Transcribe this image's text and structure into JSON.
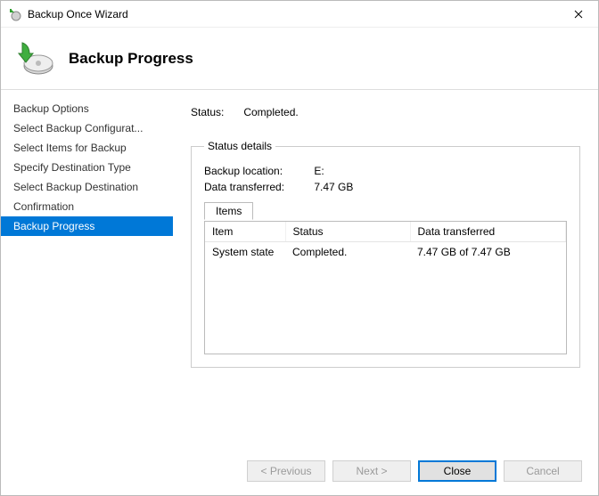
{
  "window": {
    "title": "Backup Once Wizard"
  },
  "header": {
    "title": "Backup Progress"
  },
  "sidebar": {
    "items": [
      {
        "label": "Backup Options"
      },
      {
        "label": "Select Backup Configurat..."
      },
      {
        "label": "Select Items for Backup"
      },
      {
        "label": "Specify Destination Type"
      },
      {
        "label": "Select Backup Destination"
      },
      {
        "label": "Confirmation"
      },
      {
        "label": "Backup Progress"
      }
    ],
    "selected_index": 6
  },
  "main": {
    "status_label": "Status:",
    "status_value": "Completed.",
    "group_title": "Status details",
    "backup_location_label": "Backup location:",
    "backup_location_value": "E:",
    "data_transferred_label": "Data transferred:",
    "data_transferred_value": "7.47 GB",
    "tab_label": "Items",
    "columns": {
      "item": "Item",
      "status": "Status",
      "data": "Data transferred"
    },
    "rows": [
      {
        "item": "System state",
        "status": "Completed.",
        "data": "7.47 GB of 7.47 GB"
      }
    ]
  },
  "footer": {
    "previous": "< Previous",
    "next": "Next >",
    "close": "Close",
    "cancel": "Cancel"
  }
}
